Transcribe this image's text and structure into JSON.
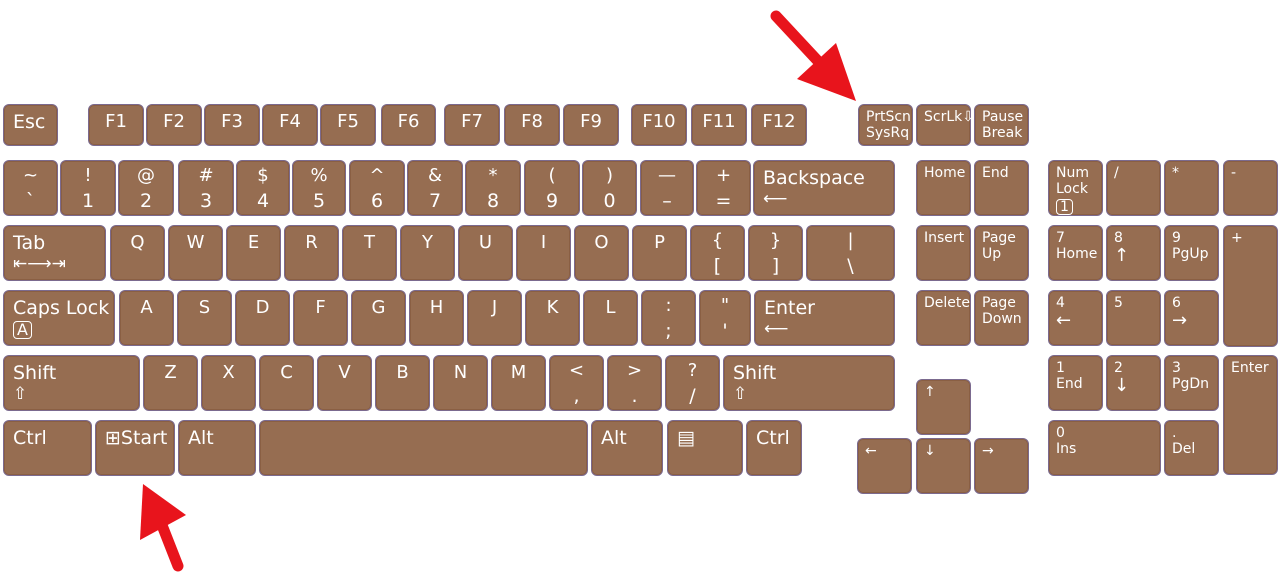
{
  "keys": [
    {
      "t": "Esc"
    },
    {
      "t": "F1"
    },
    {
      "t": "F2"
    },
    {
      "t": "F3"
    },
    {
      "t": "F4"
    },
    {
      "t": "F5"
    },
    {
      "t": "F6"
    },
    {
      "t": "F7"
    },
    {
      "t": "F8"
    },
    {
      "t": "F9"
    },
    {
      "t": "F10"
    },
    {
      "t": "F11"
    },
    {
      "t": "F12"
    },
    {
      "t": "PrtScn",
      "b": "SysRq"
    },
    {
      "t": "ScrLk⇩"
    },
    {
      "t": "Pause",
      "b": "Break"
    },
    {
      "t": "~",
      "b": "`"
    },
    {
      "t": "!",
      "b": "1"
    },
    {
      "t": "@",
      "b": "2"
    },
    {
      "t": "#",
      "b": "3"
    },
    {
      "t": "$",
      "b": "4"
    },
    {
      "t": "%",
      "b": "5"
    },
    {
      "t": "^",
      "b": "6"
    },
    {
      "t": "&",
      "b": "7"
    },
    {
      "t": "*",
      "b": "8"
    },
    {
      "t": "(",
      "b": "9"
    },
    {
      "t": ")",
      "b": "0"
    },
    {
      "t": "—",
      "b": "–"
    },
    {
      "t": "+",
      "b": "="
    },
    {
      "t": "Backspace",
      "b": "⟵"
    },
    {
      "t": "Home"
    },
    {
      "t": "End"
    },
    {
      "t": "Num",
      "m": "Lock",
      "b": "1"
    },
    {
      "t": "/"
    },
    {
      "t": "*"
    },
    {
      "t": "-"
    },
    {
      "t": "Tab",
      "b": "⇤⟶⇥"
    },
    {
      "t": "Q"
    },
    {
      "t": "W"
    },
    {
      "t": "E"
    },
    {
      "t": "R"
    },
    {
      "t": "T"
    },
    {
      "t": "Y"
    },
    {
      "t": "U"
    },
    {
      "t": "I"
    },
    {
      "t": "O"
    },
    {
      "t": "P"
    },
    {
      "t": "{",
      "b": "["
    },
    {
      "t": "}",
      "b": "]"
    },
    {
      "t": "|",
      "b": "\\"
    },
    {
      "t": "Insert"
    },
    {
      "t": "Page",
      "b": "Up"
    },
    {
      "t": "7",
      "b": "Home"
    },
    {
      "t": "8",
      "b": "↑"
    },
    {
      "t": "9",
      "b": "PgUp"
    },
    {
      "t": "+"
    },
    {
      "t": "Caps Lock",
      "b": "A"
    },
    {
      "t": "A"
    },
    {
      "t": "S"
    },
    {
      "t": "D"
    },
    {
      "t": "F"
    },
    {
      "t": "G"
    },
    {
      "t": "H"
    },
    {
      "t": "J"
    },
    {
      "t": "K"
    },
    {
      "t": "L"
    },
    {
      "t": ":",
      "b": ";"
    },
    {
      "t": "\"",
      "b": "'"
    },
    {
      "t": "Enter",
      "b": "⟵"
    },
    {
      "t": "Delete"
    },
    {
      "t": "Page",
      "b": "Down"
    },
    {
      "t": "4",
      "b": "←"
    },
    {
      "t": "5"
    },
    {
      "t": "6",
      "b": "→"
    },
    {
      "t": "Shift",
      "b": "⇧"
    },
    {
      "t": "Z"
    },
    {
      "t": "X"
    },
    {
      "t": "C"
    },
    {
      "t": "V"
    },
    {
      "t": "B"
    },
    {
      "t": "N"
    },
    {
      "t": "M"
    },
    {
      "t": "<",
      "b": ","
    },
    {
      "t": ">",
      "b": "."
    },
    {
      "t": "?",
      "b": "/"
    },
    {
      "t": "Shift",
      "b": "⇧"
    },
    {
      "t": "↑"
    },
    {
      "t": "1",
      "b": "End"
    },
    {
      "t": "2",
      "b": "↓"
    },
    {
      "t": "3",
      "b": "PgDn"
    },
    {
      "t": "Enter"
    },
    {
      "t": "Ctrl"
    },
    {
      "t": "⊞Start"
    },
    {
      "t": "Alt"
    },
    {
      "t": ""
    },
    {
      "t": "Alt"
    },
    {
      "t": "▤"
    },
    {
      "t": "Ctrl"
    },
    {
      "t": "←"
    },
    {
      "t": "↓"
    },
    {
      "t": "→"
    },
    {
      "t": "0",
      "b": "Ins"
    },
    {
      "t": ".",
      "b": "Del"
    }
  ],
  "colors": {
    "key": "#966d51",
    "arrow": "#e8141c"
  },
  "annotations": [
    "arrow pointing to PrtScn SysRq key",
    "arrow pointing to Start key"
  ]
}
